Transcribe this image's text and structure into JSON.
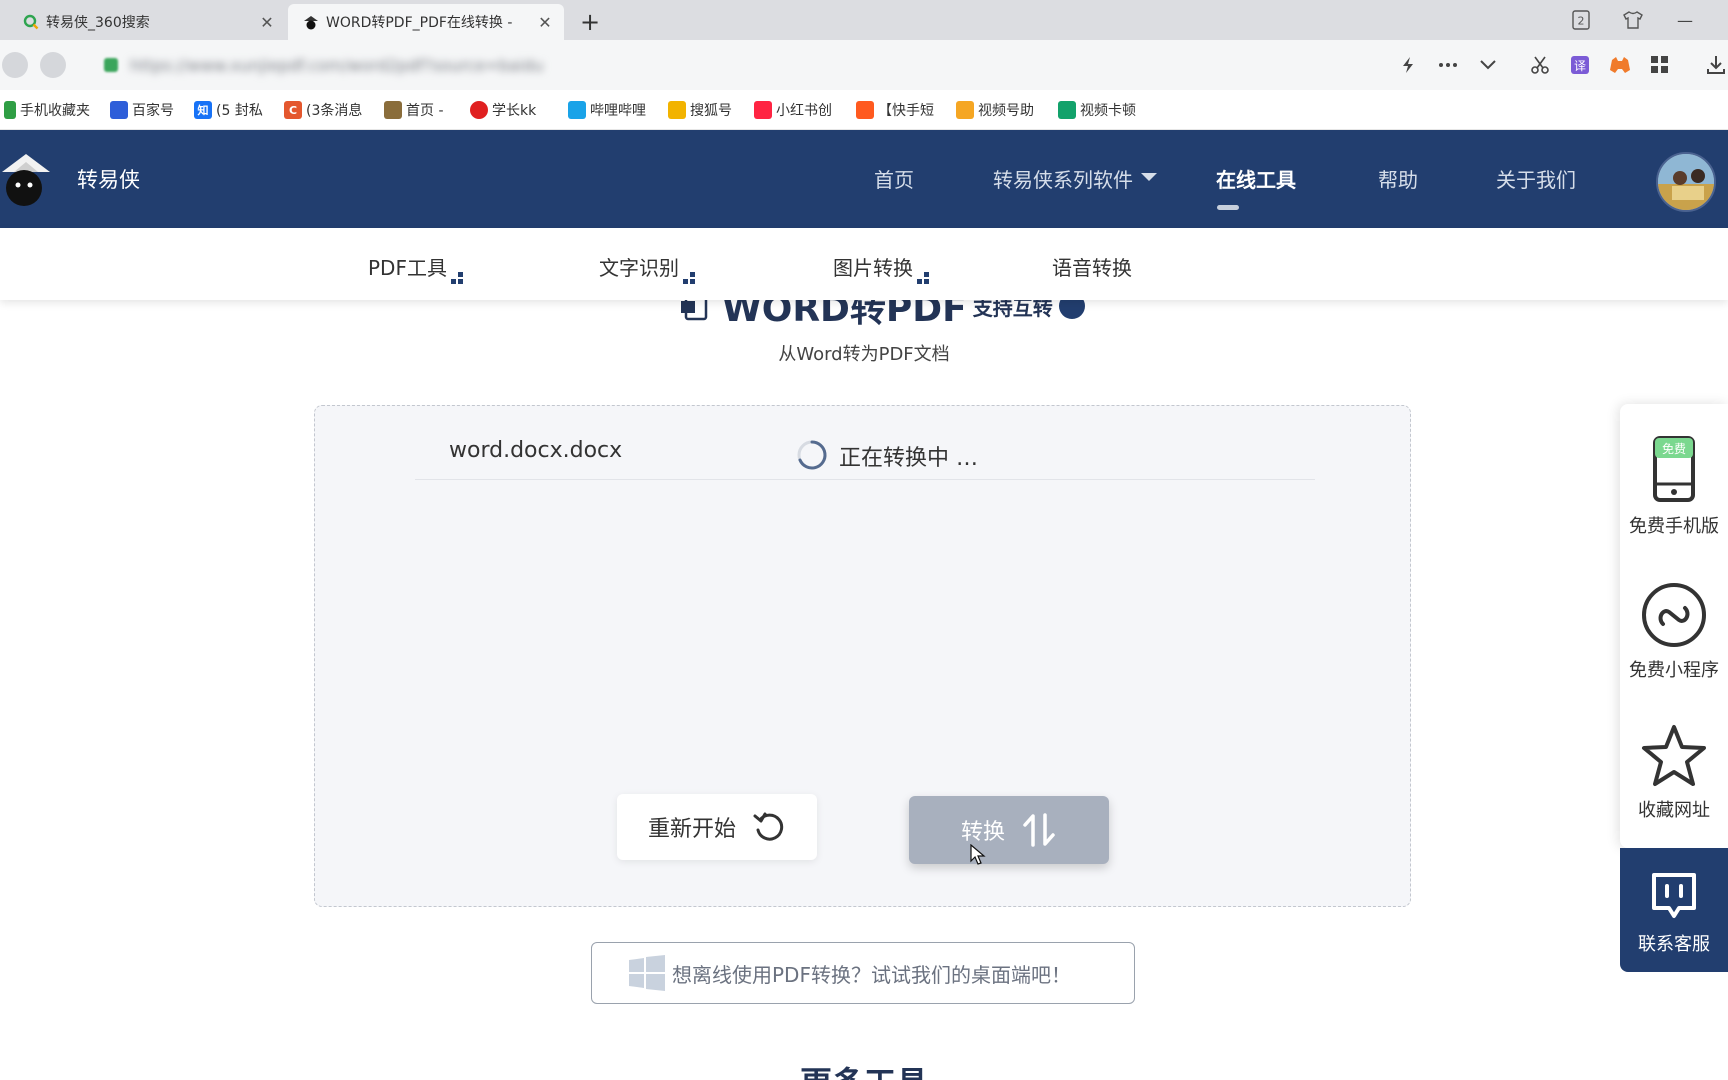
{
  "browser": {
    "tabs": [
      {
        "label": "转易侠_360搜索",
        "close": "✕"
      },
      {
        "label": "WORD转PDF_PDF在线转换 -",
        "close": "✕"
      }
    ],
    "new_tab": "+",
    "window_badge": "2",
    "window_controls": [
      "—"
    ],
    "url": "https://www.xunjiepdf.com/word2pdf?source=baidu",
    "toolbar_icons": [
      "lightning-icon",
      "more-icon",
      "chevron-down-icon",
      "scissors-icon",
      "translate-icon",
      "game-icon",
      "apps-icon",
      "download-icon"
    ],
    "translate_glyph": "译",
    "bookmarks": [
      {
        "label": "手机收藏夹",
        "color": "#2f9e44",
        "glyph": ""
      },
      {
        "label": "百家号",
        "color": "#2e5ed9",
        "glyph": ""
      },
      {
        "label": "(5 封私",
        "color": "#1772f6",
        "glyph": "知"
      },
      {
        "label": "(3条消息",
        "color": "#e4572e",
        "glyph": "C"
      },
      {
        "label": "首页 -",
        "color": "#8a6d3b",
        "glyph": ""
      },
      {
        "label": "学长kk",
        "color": "#e02020",
        "glyph": ""
      },
      {
        "label": "哔哩哔哩",
        "color": "#1aa3e8",
        "glyph": ""
      },
      {
        "label": "搜狐号",
        "color": "#f2b300",
        "glyph": ""
      },
      {
        "label": "小红书创",
        "color": "#ff2442",
        "glyph": ""
      },
      {
        "label": "【快手短",
        "color": "#ff5a1f",
        "glyph": ""
      },
      {
        "label": "视频号助",
        "color": "#f5a623",
        "glyph": ""
      },
      {
        "label": "视频卡顿",
        "color": "#12a26b",
        "glyph": ""
      }
    ]
  },
  "site": {
    "brand": "转易侠",
    "nav": [
      {
        "label": "首页",
        "active": false
      },
      {
        "label": "转易侠系列软件",
        "active": false,
        "dropdown": true
      },
      {
        "label": "在线工具",
        "active": true
      },
      {
        "label": "帮助",
        "active": false
      },
      {
        "label": "关于我们",
        "active": false
      }
    ],
    "subnav": [
      "PDF工具",
      "文字识别",
      "图片转换",
      "语音转换"
    ]
  },
  "main": {
    "title": "WORD转PDF",
    "title_suffix": "支持互转",
    "subtitle": "从Word转为PDF文档",
    "file_name": "word.docx.docx",
    "status": "正在转换中 …",
    "restart_label": "重新开始",
    "convert_label": "转换",
    "desktop_promo": "想离线使用PDF转换？试试我们的桌面端吧！",
    "more_tools": "更多工具"
  },
  "float": {
    "mobile": "免费手机版",
    "mobile_badge": "免费",
    "miniprogram": "免费小程序",
    "bookmark": "收藏网址",
    "contact": "联系客服"
  },
  "colors": {
    "nav_bg": "#223e6f",
    "convert_btn": "#a8b0be",
    "dropzone_bg": "#f5f6f9"
  }
}
